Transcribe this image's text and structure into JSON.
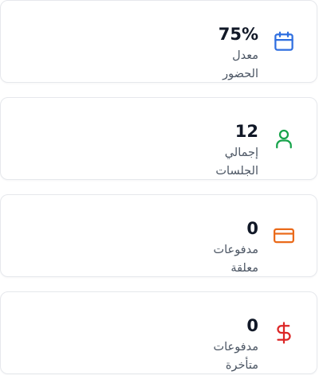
{
  "cards": [
    {
      "value": "75%",
      "label": "معدل الحضور",
      "icon": "calendar-icon",
      "color": "#2f6fe0"
    },
    {
      "value": "12",
      "label": "إجمالي الجلسات",
      "icon": "user-icon",
      "color": "#16a34a"
    },
    {
      "value": "0",
      "label": "مدفوعات معلقة",
      "icon": "credit-card-icon",
      "color": "#ea6a1a"
    },
    {
      "value": "0",
      "label": "مدفوعات متأخرة",
      "icon": "dollar-icon",
      "color": "#dc2626"
    }
  ]
}
